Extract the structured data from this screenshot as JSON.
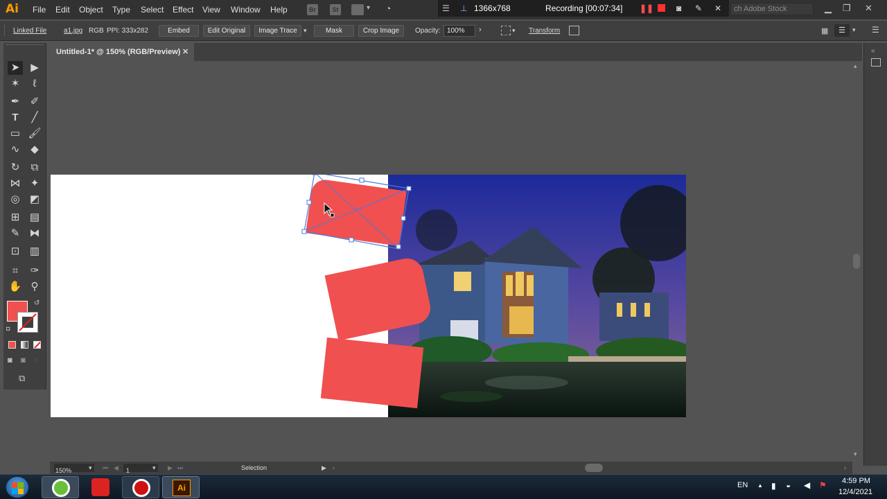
{
  "menubar": {
    "logo": "Ai",
    "items": [
      "File",
      "Edit",
      "Object",
      "Type",
      "Select",
      "Effect",
      "View",
      "Window",
      "Help"
    ],
    "icons": [
      "br-icon",
      "st-icon",
      "workspace-icon",
      "gpu-icon"
    ],
    "stock_placeholder": "ch Adobe Stock"
  },
  "recorder": {
    "resolution": "1366x768",
    "status": "Recording [00:07:34]"
  },
  "controlbar": {
    "linked_file": "Linked File",
    "file_name": "a1.jpg",
    "color_mode": "RGB",
    "ppi": "PPI: 333x282",
    "embed": "Embed",
    "edit_original": "Edit Original",
    "image_trace": "Image Trace",
    "mask": "Mask",
    "crop_image": "Crop Image",
    "opacity_label": "Opacity:",
    "opacity_value": "100%",
    "transform": "Transform"
  },
  "document": {
    "tab_title": "Untitled-1* @ 150% (RGB/Preview)"
  },
  "statusbar": {
    "zoom": "150%",
    "artboard_number": "1",
    "tool_name": "Selection"
  },
  "colors": {
    "accent": "#f05050",
    "app_bg": "#535353",
    "panel": "#3f3f3f",
    "selection": "#4b7ad8"
  },
  "taskbar": {
    "language": "EN",
    "time": "4:59 PM",
    "date": "12/4/2021"
  }
}
